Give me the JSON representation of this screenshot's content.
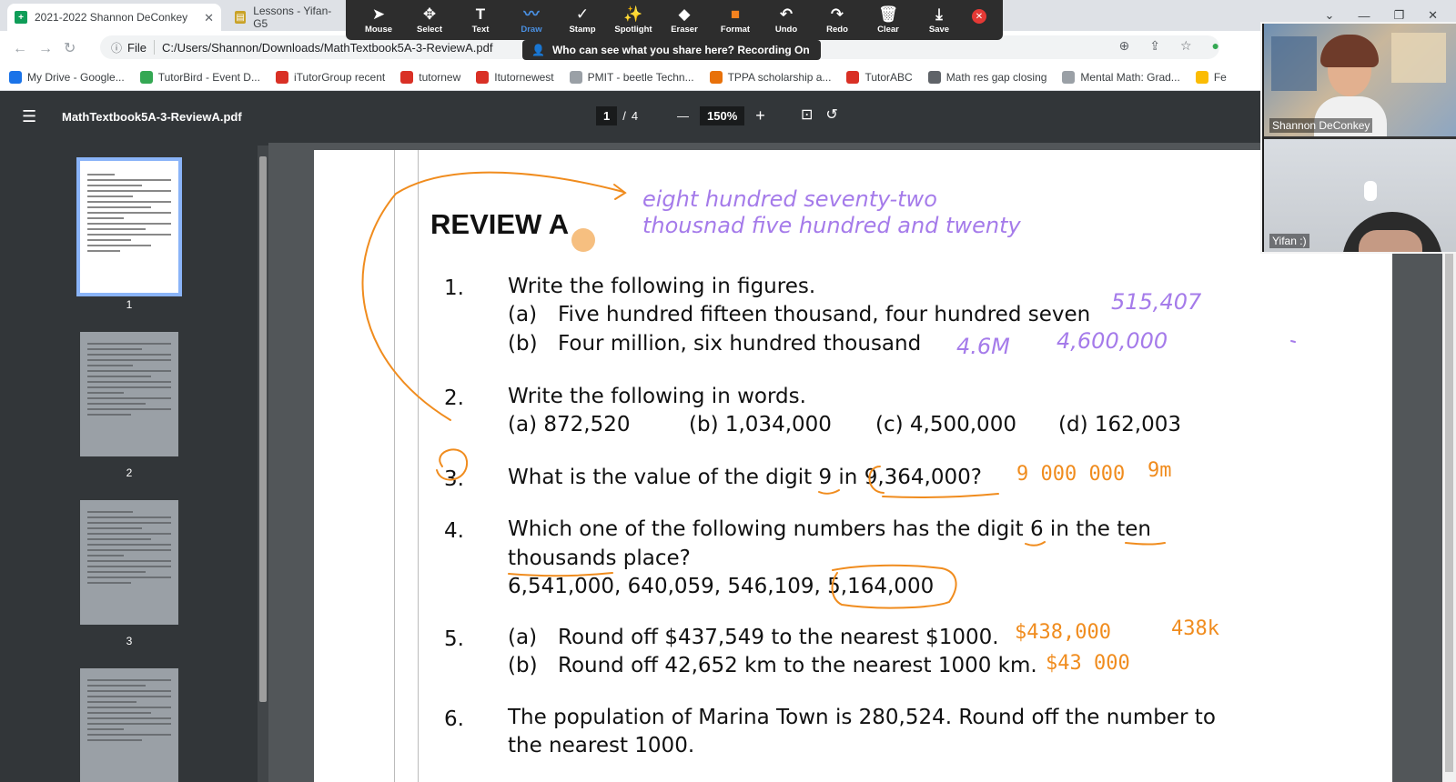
{
  "browser": {
    "tabs": [
      {
        "title": "2021-2022 Shannon DeConkey",
        "icon": "sheets-icon"
      },
      {
        "title": "Lessons - Yifan-G5",
        "icon": "doc-icon"
      }
    ],
    "address": {
      "label": "File",
      "url": "C:/Users/Shannon/Downloads/MathTextbook5A-3-ReviewA.pdf"
    },
    "bookmarks": [
      {
        "label": "My Drive - Google...",
        "color": "#1a73e8"
      },
      {
        "label": "TutorBird - Event D...",
        "color": "#34a853"
      },
      {
        "label": "iTutorGroup recent",
        "color": "#d93025"
      },
      {
        "label": "tutornew",
        "color": "#d93025"
      },
      {
        "label": "Itutornewest",
        "color": "#d93025"
      },
      {
        "label": "PMIT - beetle Techn...",
        "color": "#9aa0a6"
      },
      {
        "label": "TPPA scholarship a...",
        "color": "#e8710a"
      },
      {
        "label": "TutorABC",
        "color": "#d93025"
      },
      {
        "label": "Math res gap closing",
        "color": "#5f6368"
      },
      {
        "label": "Mental Math: Grad...",
        "color": "#9aa0a6"
      },
      {
        "label": "Fe",
        "color": "#fbbc04"
      }
    ]
  },
  "annotate_toolbar": {
    "tools": [
      {
        "label": "Mouse",
        "icon": "mouse-pointer-icon",
        "glyph": "➤"
      },
      {
        "label": "Select",
        "icon": "select-move-icon",
        "glyph": "✥"
      },
      {
        "label": "Text",
        "icon": "text-icon",
        "glyph": "T"
      },
      {
        "label": "Draw",
        "icon": "draw-icon",
        "glyph": "〰"
      },
      {
        "label": "Stamp",
        "icon": "stamp-check-icon",
        "glyph": "✓"
      },
      {
        "label": "Spotlight",
        "icon": "spotlight-wand-icon",
        "glyph": "✨"
      },
      {
        "label": "Eraser",
        "icon": "eraser-icon",
        "glyph": "◆"
      },
      {
        "label": "Format",
        "icon": "format-color-icon",
        "glyph": "■"
      },
      {
        "label": "Undo",
        "icon": "undo-icon",
        "glyph": "↶"
      },
      {
        "label": "Redo",
        "icon": "redo-icon",
        "glyph": "↷"
      },
      {
        "label": "Clear",
        "icon": "trash-icon",
        "glyph": "🗑"
      },
      {
        "label": "Save",
        "icon": "save-download-icon",
        "glyph": "⤓"
      }
    ],
    "active_tool": "Draw",
    "share_banner": "Who can see what you share here? Recording On"
  },
  "pdf": {
    "filename": "MathTextbook5A-3-ReviewA.pdf",
    "current_page": "1",
    "total_pages": "4",
    "zoom": "150%",
    "thumbnails": [
      "1",
      "2",
      "3"
    ]
  },
  "document": {
    "heading": "REVIEW A",
    "q1": {
      "num": "1.",
      "text": "Write the following in figures.",
      "a_label": "(a)",
      "a": "Five hundred fifteen thousand, four hundred seven",
      "b_label": "(b)",
      "b": "Four million, six hundred thousand"
    },
    "q2": {
      "num": "2.",
      "text": "Write the following in words.",
      "a": "(a)   872,520",
      "b": "(b)   1,034,000",
      "c": "(c)   4,500,000",
      "d": "(d)   162,003"
    },
    "q3": {
      "num": "3.",
      "text_pre": "What is the value of the digit 9 in ",
      "number": "9,364,000?"
    },
    "q4": {
      "num": "4.",
      "line1": "Which one of the following numbers has the digit 6 in the ten",
      "line2": "thousands place?",
      "options": "6,541,000,   640,059,   546,109,",
      "circled": "5,164,000"
    },
    "q5": {
      "num": "5.",
      "a_label": "(a)",
      "a": "Round off $437,549 to the nearest $1000.",
      "b_label": "(b)",
      "b": "Round off 42,652 km to the nearest 1000 km."
    },
    "q6": {
      "num": "6.",
      "line1": "The population of Marina Town is 280,524. Round off the number to",
      "line2": "the nearest 1000."
    }
  },
  "handwriting": {
    "words_line1": "eight hundred seventy-two",
    "words_line2": "thousnad five hundred and twenty",
    "q1a": "515,407",
    "q1b_short": "4.6M",
    "q1b": "4,600,000",
    "q3_ans": "9 000 000",
    "q3_abbr": "9m",
    "q5a_ans": "$438,000",
    "q5a_abbr": "438k",
    "q5b_ans": "$43 000"
  },
  "participants": [
    {
      "name": "Shannon DeConkey"
    },
    {
      "name": "Yifan :)"
    }
  ],
  "colors": {
    "ink_orange": "#f08c1e",
    "ink_purple": "#a57bea",
    "accent_blue": "#8ab4f8"
  }
}
